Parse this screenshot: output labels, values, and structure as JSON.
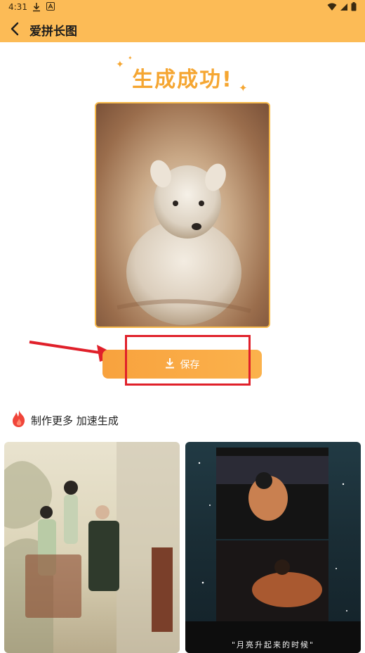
{
  "status_bar": {
    "time": "4:31"
  },
  "toolbar": {
    "title": "爱拼长图",
    "back_icon": "back-arrow-icon"
  },
  "main": {
    "success_title": "生成成功!",
    "save_label": "保存",
    "more_label": "制作更多 加速生成"
  },
  "gallery": {
    "cards": [
      {
        "caption": ""
      },
      {
        "caption": "\"月亮升起来的时候\""
      }
    ]
  },
  "colors": {
    "accent": "#fcbb56",
    "button": "#f8a23e",
    "highlight": "#e0202a"
  }
}
